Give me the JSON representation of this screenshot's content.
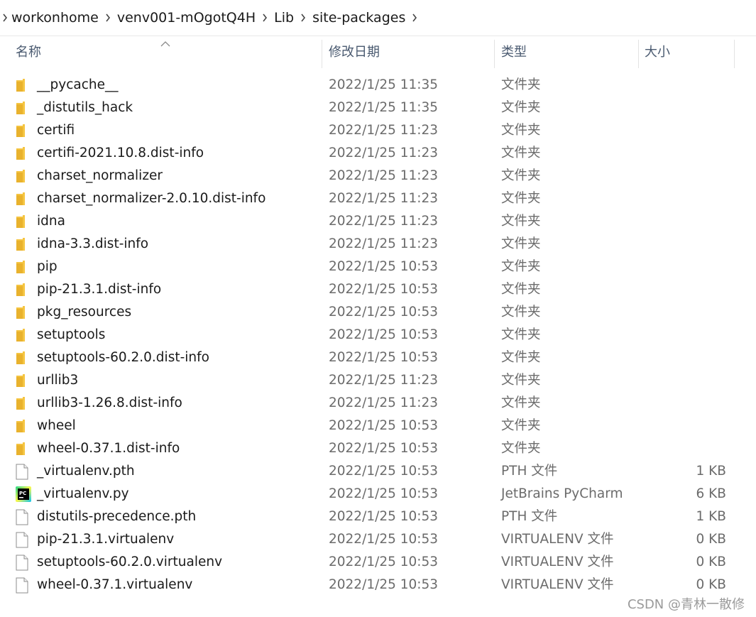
{
  "breadcrumb": [
    "workonhome",
    "venv001-mOgotQ4H",
    "Lib",
    "site-packages"
  ],
  "columns": {
    "name": "名称",
    "date": "修改日期",
    "type": "类型",
    "size": "大小"
  },
  "files": [
    {
      "name": "__pycache__",
      "date": "2022/1/25 11:35",
      "type": "文件夹",
      "size": "",
      "icon": "folder-icon"
    },
    {
      "name": "_distutils_hack",
      "date": "2022/1/25 11:35",
      "type": "文件夹",
      "size": "",
      "icon": "folder-icon"
    },
    {
      "name": "certifi",
      "date": "2022/1/25 11:23",
      "type": "文件夹",
      "size": "",
      "icon": "folder-icon"
    },
    {
      "name": "certifi-2021.10.8.dist-info",
      "date": "2022/1/25 11:23",
      "type": "文件夹",
      "size": "",
      "icon": "folder-icon"
    },
    {
      "name": "charset_normalizer",
      "date": "2022/1/25 11:23",
      "type": "文件夹",
      "size": "",
      "icon": "folder-icon"
    },
    {
      "name": "charset_normalizer-2.0.10.dist-info",
      "date": "2022/1/25 11:23",
      "type": "文件夹",
      "size": "",
      "icon": "folder-icon"
    },
    {
      "name": "idna",
      "date": "2022/1/25 11:23",
      "type": "文件夹",
      "size": "",
      "icon": "folder-icon"
    },
    {
      "name": "idna-3.3.dist-info",
      "date": "2022/1/25 11:23",
      "type": "文件夹",
      "size": "",
      "icon": "folder-icon"
    },
    {
      "name": "pip",
      "date": "2022/1/25 10:53",
      "type": "文件夹",
      "size": "",
      "icon": "folder-icon"
    },
    {
      "name": "pip-21.3.1.dist-info",
      "date": "2022/1/25 10:53",
      "type": "文件夹",
      "size": "",
      "icon": "folder-icon"
    },
    {
      "name": "pkg_resources",
      "date": "2022/1/25 10:53",
      "type": "文件夹",
      "size": "",
      "icon": "folder-icon"
    },
    {
      "name": "setuptools",
      "date": "2022/1/25 10:53",
      "type": "文件夹",
      "size": "",
      "icon": "folder-icon"
    },
    {
      "name": "setuptools-60.2.0.dist-info",
      "date": "2022/1/25 10:53",
      "type": "文件夹",
      "size": "",
      "icon": "folder-icon"
    },
    {
      "name": "urllib3",
      "date": "2022/1/25 11:23",
      "type": "文件夹",
      "size": "",
      "icon": "folder-icon"
    },
    {
      "name": "urllib3-1.26.8.dist-info",
      "date": "2022/1/25 11:23",
      "type": "文件夹",
      "size": "",
      "icon": "folder-icon"
    },
    {
      "name": "wheel",
      "date": "2022/1/25 10:53",
      "type": "文件夹",
      "size": "",
      "icon": "folder-icon"
    },
    {
      "name": "wheel-0.37.1.dist-info",
      "date": "2022/1/25 10:53",
      "type": "文件夹",
      "size": "",
      "icon": "folder-icon"
    },
    {
      "name": "_virtualenv.pth",
      "date": "2022/1/25 10:53",
      "type": "PTH 文件",
      "size": "1 KB",
      "icon": "file-icon"
    },
    {
      "name": "_virtualenv.py",
      "date": "2022/1/25 10:53",
      "type": "JetBrains PyCharm",
      "size": "6 KB",
      "icon": "pycharm-icon"
    },
    {
      "name": "distutils-precedence.pth",
      "date": "2022/1/25 10:53",
      "type": "PTH 文件",
      "size": "1 KB",
      "icon": "file-icon"
    },
    {
      "name": "pip-21.3.1.virtualenv",
      "date": "2022/1/25 10:53",
      "type": "VIRTUALENV 文件",
      "size": "0 KB",
      "icon": "file-icon"
    },
    {
      "name": "setuptools-60.2.0.virtualenv",
      "date": "2022/1/25 10:53",
      "type": "VIRTUALENV 文件",
      "size": "0 KB",
      "icon": "file-icon"
    },
    {
      "name": "wheel-0.37.1.virtualenv",
      "date": "2022/1/25 10:53",
      "type": "VIRTUALENV 文件",
      "size": "0 KB",
      "icon": "file-icon"
    }
  ],
  "watermark": "CSDN @青林一散修",
  "colors": {
    "folder": "#f5c542",
    "header_text": "#4a5a70",
    "secondary_text": "#6b6b6b"
  }
}
